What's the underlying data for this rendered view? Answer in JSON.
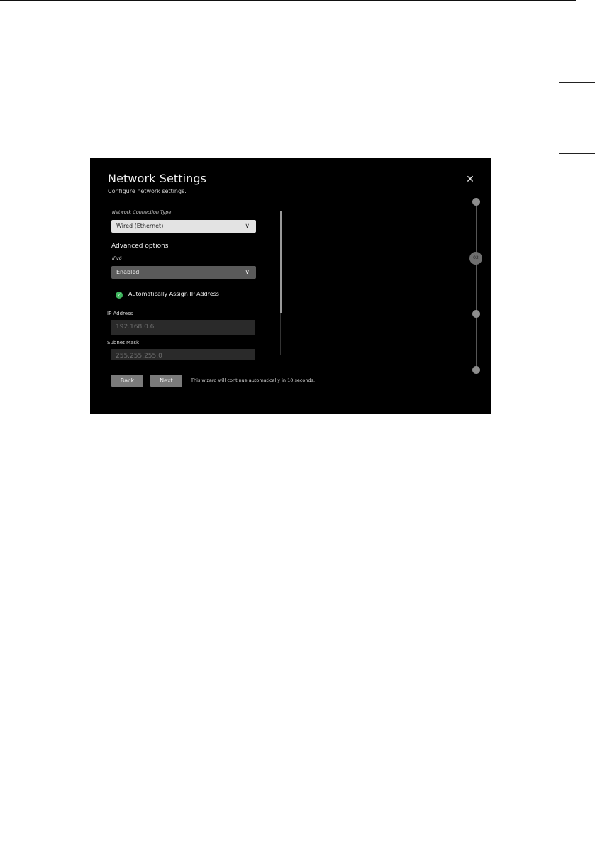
{
  "dialog": {
    "title": "Network Settings",
    "subtitle": "Configure network settings.",
    "close_icon": "close-icon"
  },
  "form": {
    "connection_type_label": "Network Connection Type",
    "connection_type_value": "Wired (Ethernet)",
    "advanced_heading": "Advanced options",
    "ipv6_label": "IPv6",
    "ipv6_value": "Enabled",
    "auto_assign_label": "Automatically Assign IP Address",
    "auto_assign_checked": true,
    "ip_address_label": "IP Address",
    "ip_address_value": "192.168.0.6",
    "subnet_mask_label": "Subnet Mask",
    "subnet_mask_value": "255.255.255.0"
  },
  "footer": {
    "back_label": "Back",
    "next_label": "Next",
    "message": "This wizard will continue automatically in 10 seconds."
  },
  "stepper": {
    "current_step_label": "02"
  },
  "colors": {
    "background": "#000000",
    "check_accent": "#3fb55e",
    "button": "#7a7a7a"
  }
}
